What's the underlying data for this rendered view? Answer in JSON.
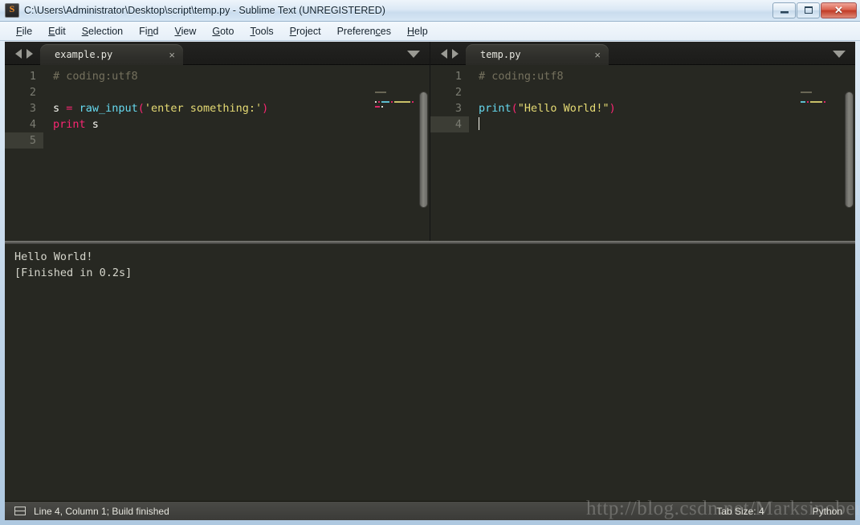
{
  "window": {
    "title": "C:\\Users\\Administrator\\Desktop\\script\\temp.py - Sublime Text (UNREGISTERED)",
    "icon": "sublime-text-icon",
    "controls": {
      "minimize": "─",
      "maximize": "□",
      "close": "✕"
    }
  },
  "menubar": {
    "items": [
      {
        "label": "File",
        "accel_index": 0
      },
      {
        "label": "Edit",
        "accel_index": 0
      },
      {
        "label": "Selection",
        "accel_index": 0
      },
      {
        "label": "Find",
        "accel_index": 2
      },
      {
        "label": "View",
        "accel_index": 0
      },
      {
        "label": "Goto",
        "accel_index": 0
      },
      {
        "label": "Tools",
        "accel_index": 0
      },
      {
        "label": "Project",
        "accel_index": 0
      },
      {
        "label": "Preferences",
        "accel_index": 8
      },
      {
        "label": "Help",
        "accel_index": 0
      }
    ]
  },
  "panes": [
    {
      "id": "left",
      "tab": {
        "label": "example.py",
        "close": "×"
      },
      "gutter": [
        "1",
        "2",
        "3",
        "4",
        "5"
      ],
      "active_line": 5,
      "lines": [
        {
          "tokens": [
            {
              "text": "# coding:utf8",
              "cls": "tok-comment"
            }
          ]
        },
        {
          "tokens": [
            {
              "text": "",
              "cls": "tok-plain"
            }
          ]
        },
        {
          "tokens": [
            {
              "text": "s",
              "cls": "tok-plain"
            },
            {
              "text": " ",
              "cls": "tok-plain"
            },
            {
              "text": "=",
              "cls": "tok-operator"
            },
            {
              "text": " ",
              "cls": "tok-plain"
            },
            {
              "text": "raw_input",
              "cls": "tok-func"
            },
            {
              "text": "(",
              "cls": "tok-operator"
            },
            {
              "text": "'enter something:'",
              "cls": "tok-string"
            },
            {
              "text": ")",
              "cls": "tok-operator"
            }
          ]
        },
        {
          "tokens": [
            {
              "text": "print",
              "cls": "tok-keyword"
            },
            {
              "text": " ",
              "cls": "tok-plain"
            },
            {
              "text": "s",
              "cls": "tok-plain"
            }
          ]
        },
        {
          "tokens": [
            {
              "text": "",
              "cls": "tok-plain"
            }
          ]
        }
      ]
    },
    {
      "id": "right",
      "tab": {
        "label": "temp.py",
        "close": "×"
      },
      "gutter": [
        "1",
        "2",
        "3",
        "4"
      ],
      "active_line": 4,
      "caret_line": 4,
      "lines": [
        {
          "tokens": [
            {
              "text": "# coding:utf8",
              "cls": "tok-comment"
            }
          ]
        },
        {
          "tokens": [
            {
              "text": "",
              "cls": "tok-plain"
            }
          ]
        },
        {
          "tokens": [
            {
              "text": "print",
              "cls": "tok-func"
            },
            {
              "text": "(",
              "cls": "tok-operator"
            },
            {
              "text": "\"Hello World!\"",
              "cls": "tok-string"
            },
            {
              "text": ")",
              "cls": "tok-operator"
            }
          ]
        },
        {
          "tokens": [
            {
              "text": "",
              "cls": "tok-plain"
            }
          ]
        }
      ]
    }
  ],
  "console": {
    "lines": [
      "Hello World!",
      "[Finished in 0.2s]"
    ]
  },
  "statusbar": {
    "panel_icon": "panel-toggle-icon",
    "message": "Line 4, Column 1; Build finished",
    "tab_size": "Tab Size: 4",
    "syntax": "Python"
  },
  "watermark": "http://blog.csdn.net/Marksinoberg",
  "colors": {
    "editor_background": "#272822",
    "comment": "#75715e",
    "keyword": "#f92672",
    "function": "#66d9ef",
    "string": "#e6db74",
    "plain": "#f8f8f2",
    "gutter_text": "#7b7c72",
    "active_line": "#3c3d35",
    "chrome": "#1c1c1b",
    "statusbar": "#4a4a46",
    "titlebar_accent": "#c9dcee",
    "close_button": "#c03a26"
  }
}
